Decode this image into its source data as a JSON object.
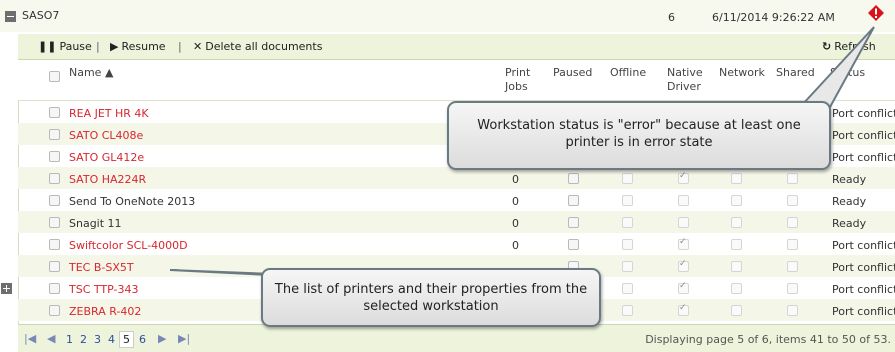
{
  "workstation": {
    "name": "SASO7",
    "count": "6",
    "datetime": "6/11/2014 9:26:22 AM",
    "status_icon": "error-icon"
  },
  "toolbar": {
    "pause": "Pause",
    "resume": "Resume",
    "delete_all": "Delete all documents",
    "refresh": "Refresh"
  },
  "columns": {
    "name": "Name ▲",
    "print_jobs": [
      "Print",
      "Jobs"
    ],
    "paused": "Paused",
    "offline": "Offline",
    "native_driver": [
      "Native",
      "Driver"
    ],
    "network": "Network",
    "shared": "Shared",
    "status": "Status"
  },
  "printers": [
    {
      "name": "REA JET HR 4K",
      "jobs": "",
      "paused": false,
      "offline": false,
      "native": false,
      "network": false,
      "shared": false,
      "status": "Port conflict",
      "error": true
    },
    {
      "name": "SATO CL408e",
      "jobs": "",
      "paused": false,
      "offline": false,
      "native": false,
      "network": false,
      "shared": false,
      "status": "Port conflict",
      "error": true
    },
    {
      "name": "SATO GL412e",
      "jobs": "",
      "paused": false,
      "offline": false,
      "native": false,
      "network": false,
      "shared": false,
      "status": "Port conflict",
      "error": true
    },
    {
      "name": "SATO HA224R",
      "jobs": "0",
      "paused": false,
      "offline": false,
      "native": true,
      "network": false,
      "shared": false,
      "status": "Ready",
      "error": true
    },
    {
      "name": "Send To OneNote 2013",
      "jobs": "0",
      "paused": false,
      "offline": false,
      "native": false,
      "network": false,
      "shared": false,
      "status": "Ready",
      "error": false
    },
    {
      "name": "Snagit 11",
      "jobs": "0",
      "paused": false,
      "offline": false,
      "native": false,
      "network": false,
      "shared": false,
      "status": "Ready",
      "error": false
    },
    {
      "name": "Swiftcolor SCL-4000D",
      "jobs": "0",
      "paused": false,
      "offline": false,
      "native": true,
      "network": false,
      "shared": false,
      "status": "Port conflict",
      "error": true
    },
    {
      "name": "TEC B-SX5T",
      "jobs": "",
      "paused": false,
      "offline": false,
      "native": true,
      "network": false,
      "shared": false,
      "status": "Port conflict",
      "error": true
    },
    {
      "name": "TSC TTP-343",
      "jobs": "",
      "paused": false,
      "offline": false,
      "native": true,
      "network": false,
      "shared": false,
      "status": "Port conflict",
      "error": true
    },
    {
      "name": "ZEBRA R-402",
      "jobs": "",
      "paused": false,
      "offline": false,
      "native": true,
      "network": false,
      "shared": false,
      "status": "Port conflict",
      "error": true
    }
  ],
  "pager": {
    "pages": [
      "1",
      "2",
      "3",
      "4",
      "5",
      "6"
    ],
    "current": "5",
    "info": "Displaying page 5 of 6, items 41 to 50 of 53."
  },
  "callouts": {
    "status": [
      "Workstation status is \"error\" because at least one",
      "printer is in error state"
    ],
    "list": [
      "The list of printers and their properties from the",
      "selected workstation"
    ]
  },
  "colors": {
    "error_text": "#d9262f",
    "accent_bg": "#eef3dc",
    "alt_row": "#f4f7e8"
  }
}
